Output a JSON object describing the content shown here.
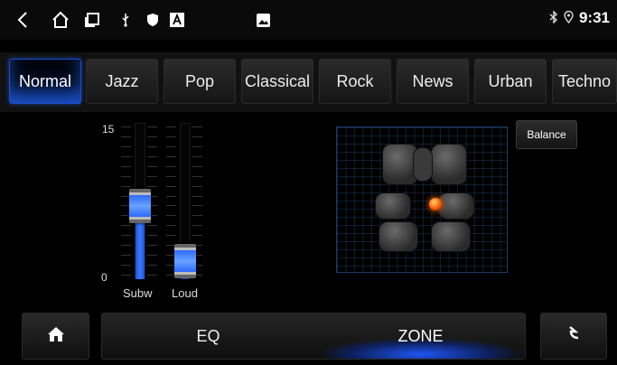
{
  "status_bar": {
    "time": "9:31",
    "icons": [
      "back-icon",
      "home-outline-icon",
      "recents-icon",
      "usb-icon",
      "shield-icon",
      "a-box-icon",
      "image-icon",
      "bluetooth-icon",
      "location-icon"
    ]
  },
  "presets": {
    "items": [
      "Normal",
      "Jazz",
      "Pop",
      "Classical",
      "Rock",
      "News",
      "Urban",
      "Techno"
    ],
    "active": "Normal"
  },
  "sliders": {
    "scale_max": "15",
    "scale_min": "0",
    "subw": {
      "label": "Subw",
      "value": 7
    },
    "loud": {
      "label": "Loud",
      "value": 1
    }
  },
  "balance_label": "Balance",
  "bottom": {
    "tabs": [
      "EQ",
      "ZONE"
    ],
    "active_tab": "ZONE",
    "home_icon": "home-icon",
    "back_icon": "return-arrow-icon"
  },
  "colors": {
    "accent": "#2d6bff",
    "focus_dot": "#ff5a00"
  }
}
